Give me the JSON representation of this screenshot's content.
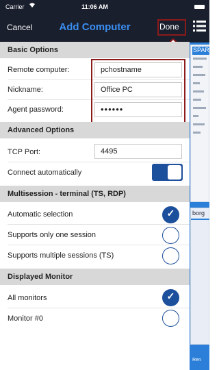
{
  "status_bar": {
    "carrier": "Carrier",
    "wifi_icon": "wifi-icon",
    "time": "11:06 AM"
  },
  "nav": {
    "cancel": "Cancel",
    "title": "Add Computer",
    "done": "Done"
  },
  "basic_options": {
    "header": "Basic Options",
    "remote_computer": {
      "label": "Remote computer:",
      "value": "pchostname"
    },
    "nickname": {
      "label": "Nickname:",
      "value": "Office PC"
    },
    "agent_password": {
      "label": "Agent password:",
      "value": "••••••"
    }
  },
  "advanced_options": {
    "header": "Advanced Options",
    "tcp_port": {
      "label": "TCP Port:",
      "value": "4495"
    },
    "connect_automatically": {
      "label": "Connect automatically",
      "on": true
    }
  },
  "multisession": {
    "header": "Multisession - terminal (TS, RDP)",
    "options": [
      {
        "label": "Automatic selection",
        "checked": true
      },
      {
        "label": "Supports only one session",
        "checked": false
      },
      {
        "label": "Supports multiple sessions (TS)",
        "checked": false
      }
    ]
  },
  "displayed_monitor": {
    "header": "Displayed Monitor",
    "options": [
      {
        "label": "All monitors",
        "checked": true
      },
      {
        "label": "Monitor #0",
        "checked": false
      }
    ]
  },
  "background": {
    "thumb1_title": "SPAR",
    "thumb2_title": "borg",
    "bottom_text": "Ren"
  },
  "colors": {
    "accent": "#1c4f9c",
    "title_blue": "#3a8ef0",
    "nav_bg": "#1a1f2e",
    "annotation_red": "#8b1a1a"
  },
  "check_glyph": "✓"
}
